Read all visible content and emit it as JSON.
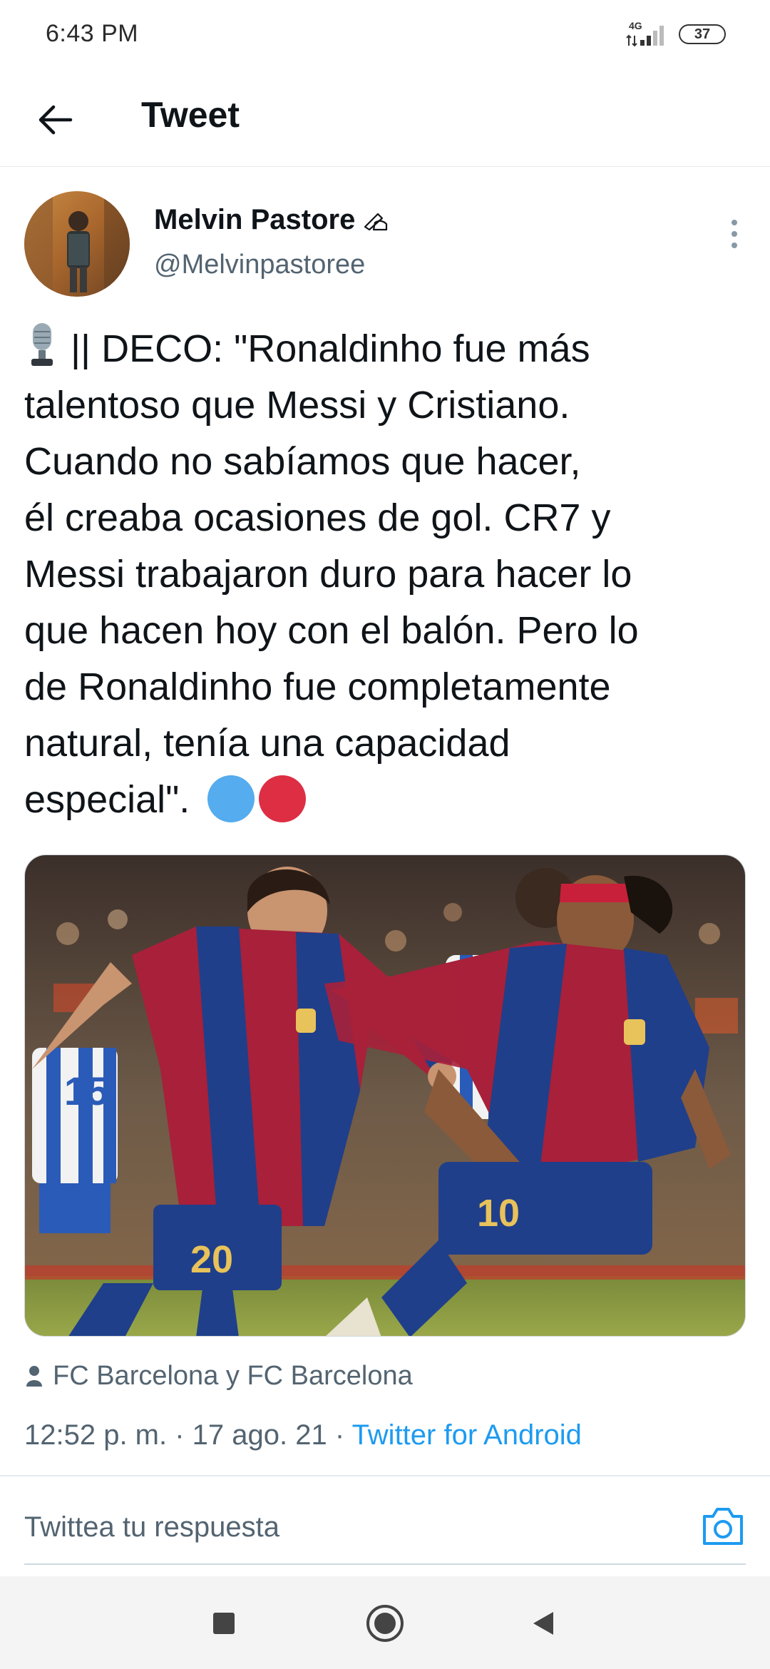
{
  "status_bar": {
    "time": "6:43 PM",
    "network": "4G",
    "battery": "37"
  },
  "header": {
    "title": "Tweet"
  },
  "tweet": {
    "author_name": "Melvin Pastore",
    "author_handle": "@Melvinpastoree",
    "text_lines": [
      "|| DECO: \"Ronaldinho fue más",
      "talentoso que Messi y Cristiano.",
      "Cuando no sabíamos que hacer,",
      "él creaba ocasiones de gol. CR7 y",
      "Messi trabajaron duro para hacer lo",
      "que hacen hoy con el balón. Pero lo",
      "de Ronaldinho fue completamente",
      "natural, tenía una capacidad",
      "especial\"."
    ],
    "tagged_people": "FC Barcelona y FC Barcelona",
    "timestamp": "12:52 p. m. · 17 ago. 21 · ",
    "source": "Twitter for Android"
  },
  "reply": {
    "placeholder": "Twittea tu respuesta"
  },
  "colors": {
    "accent": "#1d9bf0",
    "secondary_text": "#536471",
    "emoji_blue": "#55acee",
    "emoji_red": "#dd2e44"
  }
}
